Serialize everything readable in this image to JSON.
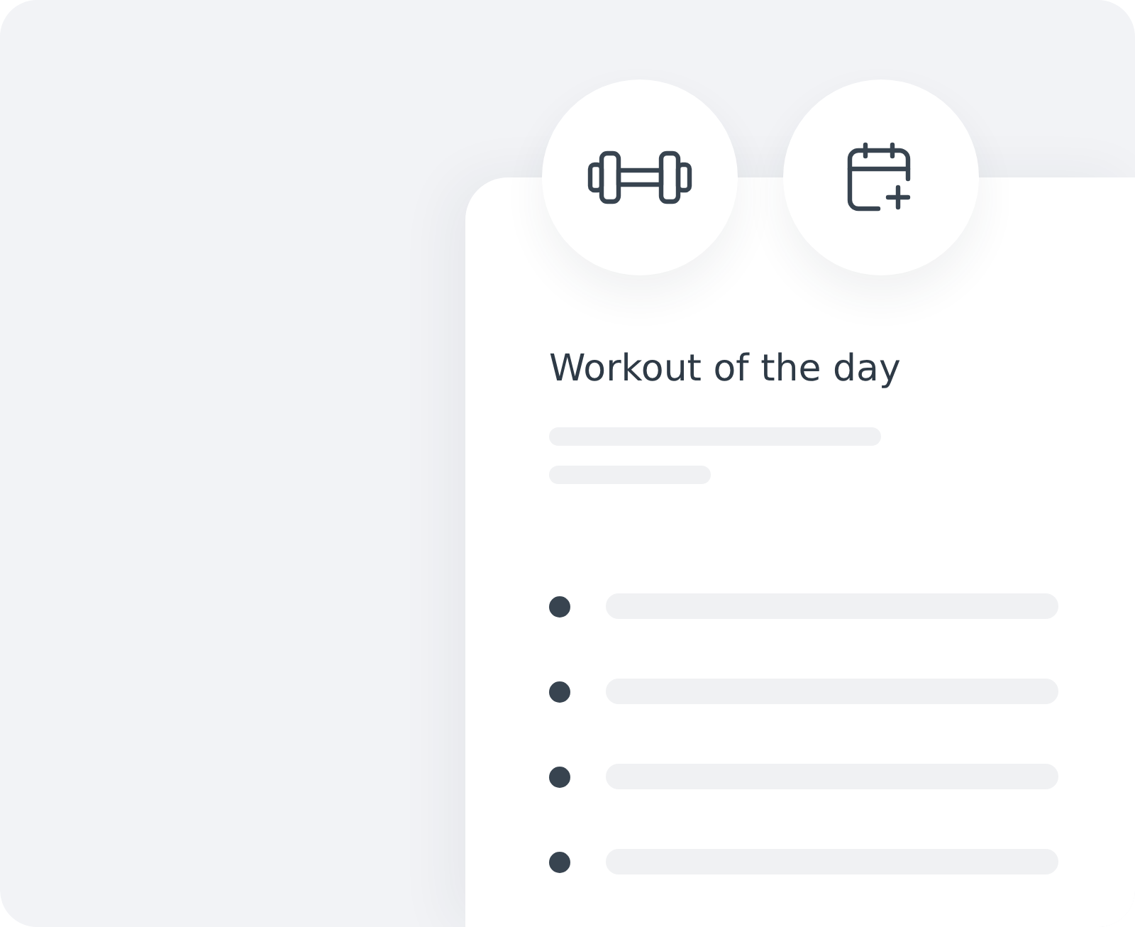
{
  "card": {
    "title": "Workout of the day"
  }
}
